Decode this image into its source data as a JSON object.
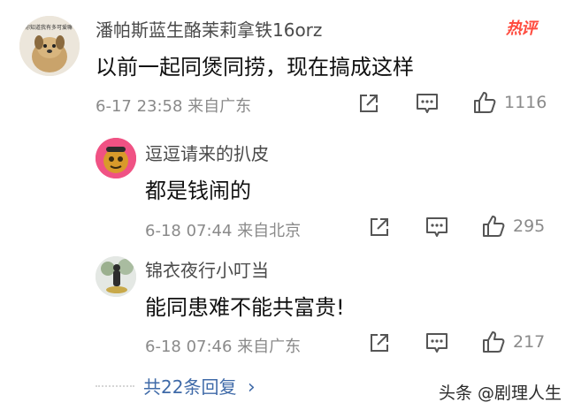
{
  "main_comment": {
    "avatar_text": "你知道我有多可爱嘛",
    "username": "潘帕斯蓝生酪茉莉拿铁16orz",
    "badge": "热评",
    "text": "以前一起同煲同捞，现在搞成这样",
    "meta": "6-17 23:58 来自广东",
    "likes": "1116"
  },
  "replies": [
    {
      "username": "逗逗请来的扒皮",
      "text": "都是钱闹的",
      "meta": "6-18 07:44 来自北京",
      "likes": "295"
    },
    {
      "username": "锦衣夜行小叮当",
      "text": "能同患难不能共富贵!",
      "meta": "6-18 07:46 来自广东",
      "likes": "217"
    }
  ],
  "more_replies": "共22条回复",
  "more_chevron": "›",
  "watermark": "头条 @剧理人生",
  "colors": {
    "hot_badge": "#ff4b3e",
    "link": "#3f6aa8",
    "meta": "#8a8a8a"
  }
}
